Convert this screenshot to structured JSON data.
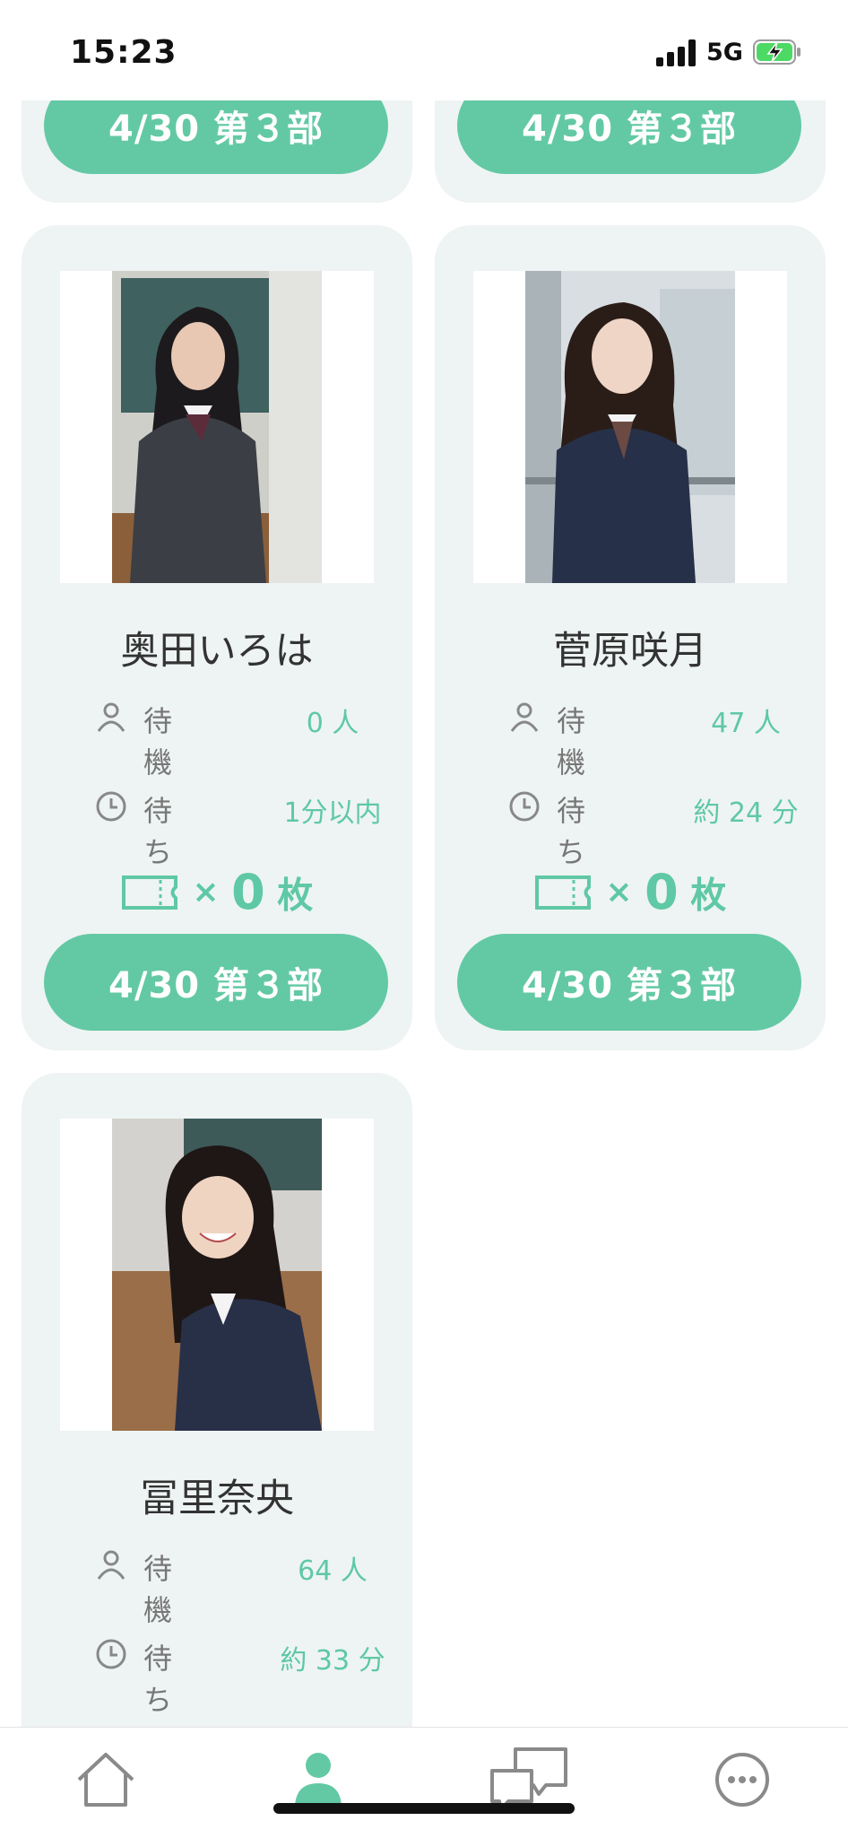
{
  "status_bar": {
    "time": "15:23",
    "network": "5G"
  },
  "cards": [
    {
      "name": "",
      "wait_label": "",
      "wait_value": "",
      "time_label": "",
      "time_value": "",
      "ticket_count": "",
      "ticket_unit": "",
      "button_label": "4/30 第３部"
    },
    {
      "name": "",
      "wait_label": "",
      "wait_value": "",
      "time_label": "",
      "time_value": "",
      "ticket_count": "",
      "ticket_unit": "",
      "button_label": "4/30 第３部"
    },
    {
      "name": "奥田いろは",
      "wait_label": "待機",
      "wait_value": "0 人",
      "time_label": "待ち",
      "time_value": "1分以内",
      "ticket_times": "×",
      "ticket_count": "0",
      "ticket_unit": "枚",
      "button_label": "4/30 第３部"
    },
    {
      "name": "菅原咲月",
      "wait_label": "待機",
      "wait_value": "47 人",
      "time_label": "待ち",
      "time_value": "約 24 分",
      "ticket_times": "×",
      "ticket_count": "0",
      "ticket_unit": "枚",
      "button_label": "4/30 第３部"
    },
    {
      "name": "冨里奈央",
      "wait_label": "待機",
      "wait_value": "64 人",
      "time_label": "待ち",
      "time_value": "約 33 分"
    }
  ],
  "tabbar": {
    "items": [
      "home-icon",
      "member-icon",
      "chat-icon",
      "more-icon"
    ],
    "active": "member-icon"
  },
  "colors": {
    "accent": "#63c9a5",
    "card_bg": "#eef4f3"
  }
}
